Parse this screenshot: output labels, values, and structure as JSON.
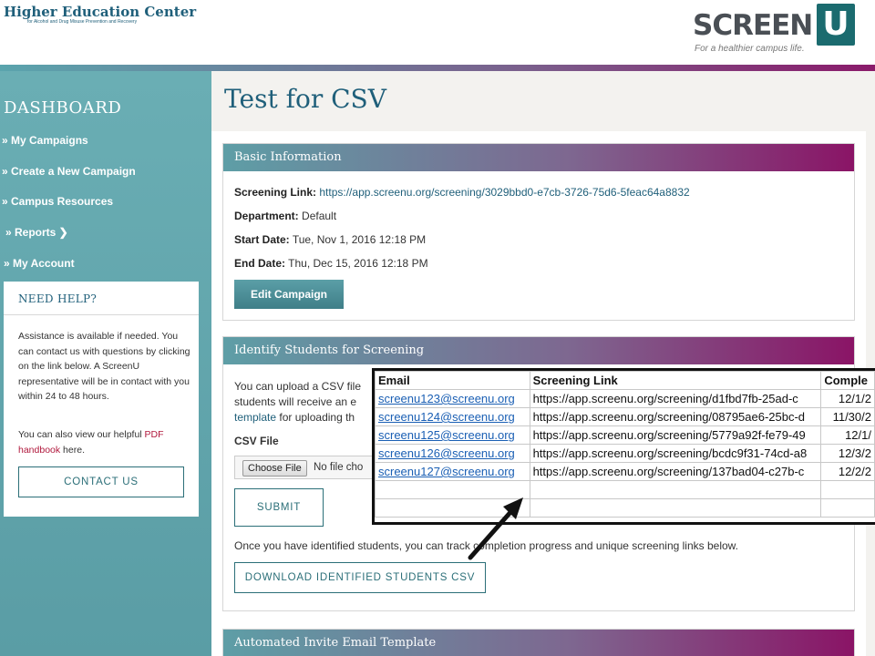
{
  "header": {
    "org_title": "Higher Education Center",
    "org_subtitle": "for Alcohol and Drug Misuse Prevention and Recovery",
    "logo_text": "SCREEN",
    "logo_letter": "U",
    "logo_tagline": "For a healthier campus life."
  },
  "sidebar": {
    "title": "DASHBOARD",
    "items": [
      {
        "label": "» My Campaigns"
      },
      {
        "label": "» Create a New Campaign"
      },
      {
        "label": "» Campus Resources"
      },
      {
        "label": "» Reports ❯"
      },
      {
        "label": "» My Account"
      }
    ],
    "help": {
      "title": "NEED HELP?",
      "text1": "Assistance is available if needed. You can contact us with questions by clicking on the link below. A ScreenU representative will be in contact with you within 24 to 48 hours.",
      "text2_pre": "You can also view our helpful ",
      "text2_link": "PDF handbook",
      "text2_post": " here.",
      "contact_label": "CONTACT US"
    }
  },
  "main": {
    "page_title": "Test for CSV",
    "basic_info": {
      "title": "Basic Information",
      "screening_link_label": "Screening Link:",
      "screening_link": "https://app.screenu.org/screening/3029bbd0-e7cb-3726-75d6-5feac64a8832",
      "department_label": "Department:",
      "department": "Default",
      "start_label": "Start Date:",
      "start": "Tue, Nov 1, 2016 12:18 PM",
      "end_label": "End Date:",
      "end": "Thu, Dec 15, 2016 12:18 PM",
      "edit_label": "Edit Campaign"
    },
    "identify": {
      "title": "Identify Students for Screening",
      "line1": "You can upload a CSV file",
      "line2": "students will receive an e",
      "line3_link": "template",
      "line3_rest": " for uploading th",
      "csv_label": "CSV File",
      "choose_label": "Choose File",
      "no_file": "No file cho",
      "submit_label": "SUBMIT",
      "progress_text": "Once you have identified students, you can track completion progress and unique screening links below.",
      "download_label": "DOWNLOAD IDENTIFIED STUDENTS CSV"
    },
    "invite": {
      "title": "Automated Invite Email Template"
    }
  },
  "sheet": {
    "headers": [
      "Email",
      "Screening Link",
      "Comple"
    ],
    "rows": [
      [
        "screenu123@screenu.org",
        "https://app.screenu.org/screening/d1fbd7fb-25ad-c",
        "12/1/2"
      ],
      [
        "screenu124@screenu.org",
        "https://app.screenu.org/screening/08795ae6-25bc-d",
        "11/30/2"
      ],
      [
        "screenu125@screenu.org",
        "https://app.screenu.org/screening/5779a92f-fe79-49",
        "12/1/"
      ],
      [
        "screenu126@screenu.org",
        "https://app.screenu.org/screening/bcdc9f31-74cd-a8",
        "12/3/2"
      ],
      [
        "screenu127@screenu.org",
        "https://app.screenu.org/screening/137bad04-c27b-c",
        "12/2/2"
      ]
    ]
  },
  "colors": {
    "teal": "#5aa4ad",
    "dark_teal": "#1f5f7a",
    "magenta": "#8a1466",
    "link_red": "#b0183c"
  }
}
